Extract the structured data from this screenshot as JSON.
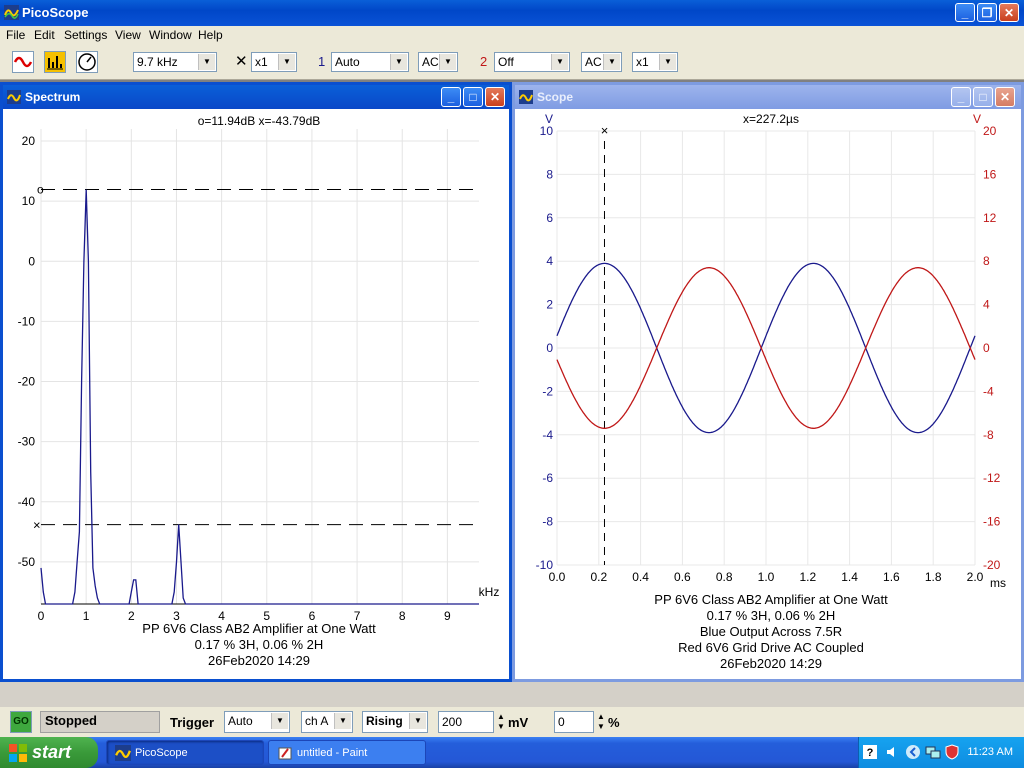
{
  "window": {
    "title": "PicoScope"
  },
  "menu": [
    "File",
    "Edit",
    "Settings",
    "View",
    "Window",
    "Help"
  ],
  "toolbar": {
    "timebase": "9.7 kHz",
    "multiplier_symbol": "✕",
    "multiplier": "x1",
    "ch1_label": "1",
    "ch1_range": "Auto",
    "ch1_coupling": "AC",
    "ch2_label": "2",
    "ch2_range": "Off",
    "ch2_coupling": "AC",
    "ch2_multiplier": "x1"
  },
  "spectrum": {
    "title": "Spectrum",
    "readout": "o=11.94dB  x=-43.79dB",
    "y_ticks": [
      "20",
      "10",
      "0",
      "-10",
      "-20",
      "-30",
      "-40",
      "-50"
    ],
    "x_ticks": [
      "0",
      "1",
      "2",
      "3",
      "4",
      "5",
      "6",
      "7",
      "8",
      "9"
    ],
    "x_unit": "kHz",
    "marker_o": "o",
    "marker_x": "×",
    "caption": [
      "PP 6V6 Class AB2 Amplifier at One Watt",
      "0.17 % 3H, 0.06 % 2H",
      "26Feb2020  14:29"
    ]
  },
  "scope": {
    "title": "Scope",
    "readout": "x=227.2µs",
    "left_unit": "V",
    "right_unit": "V",
    "marker_x": "×",
    "left_ticks": [
      "10",
      "8",
      "6",
      "4",
      "2",
      "0",
      "-2",
      "-4",
      "-6",
      "-8",
      "-10"
    ],
    "right_ticks": [
      "20",
      "16",
      "12",
      "8",
      "4",
      "0",
      "-4",
      "-8",
      "-12",
      "-16",
      "-20"
    ],
    "x_ticks": [
      "0.0",
      "0.2",
      "0.4",
      "0.6",
      "0.8",
      "1.0",
      "1.2",
      "1.4",
      "1.6",
      "1.8",
      "2.0"
    ],
    "x_unit": "ms",
    "caption": [
      "PP 6V6 Class AB2 Amplifier at One Watt",
      "0.17 % 3H, 0.06 % 2H",
      "Blue Output Across 7.5R",
      "Red 6V6 Grid Drive AC Coupled",
      "26Feb2020  14:29"
    ]
  },
  "statusbar": {
    "go_label": "GO",
    "status": "Stopped",
    "trigger_label": "Trigger",
    "trigger_mode": "Auto",
    "trigger_channel": "ch A",
    "trigger_edge": "Rising",
    "threshold": "200",
    "threshold_unit": "mV",
    "delay": "0",
    "delay_unit": "%"
  },
  "taskbar": {
    "start": "start",
    "tasks": [
      "PicoScope",
      "untitled - Paint"
    ],
    "clock": "11:23 AM"
  },
  "colors": {
    "ch_a": "#1a1a8c",
    "ch_b": "#c01818",
    "title_blue": "#0a4fcf"
  },
  "chart_data": [
    {
      "type": "line",
      "title": "Spectrum",
      "xlabel": "kHz",
      "ylabel": "dB",
      "xlim": [
        0,
        9.7
      ],
      "ylim": [
        -57,
        22
      ],
      "grid": true,
      "series": [
        {
          "values_x": [
            0,
            0.05,
            0.1,
            0.7,
            0.75,
            0.8,
            0.85,
            0.9,
            0.95,
            1.0,
            1.05,
            1.1,
            1.15,
            1.2,
            1.25,
            1.3,
            1.95,
            2.0,
            2.05,
            2.1,
            2.15,
            2.9,
            2.95,
            3.0,
            3.05,
            3.1,
            3.15,
            3.2,
            9.7
          ],
          "values_y": [
            -51,
            -55,
            -57,
            -57,
            -55,
            -50,
            -45,
            -20,
            0,
            11.9,
            0,
            -35,
            -51,
            -54,
            -56,
            -57,
            -57,
            -55,
            -53,
            -53,
            -57,
            -57,
            -55,
            -50,
            -43.8,
            -50,
            -56,
            -57,
            -57
          ]
        }
      ],
      "cursors": {
        "o_level": 11.94,
        "x_level": -43.79
      }
    },
    {
      "type": "line",
      "title": "Scope",
      "xlabel": "ms",
      "ylabel_left": "V",
      "ylabel_right": "V",
      "xlim": [
        0,
        2.0
      ],
      "ylim_left": [
        -10,
        10
      ],
      "ylim_right": [
        -20,
        20
      ],
      "grid": true,
      "series": [
        {
          "name": "Blue Output Across 7.5R",
          "axis": "left",
          "amplitude": 3.9,
          "period_ms": 1.0,
          "peak_at_ms": 0.227
        },
        {
          "name": "Red 6V6 Grid Drive AC Coupled",
          "axis": "right",
          "amplitude": 7.4,
          "period_ms": 1.0,
          "peak_at_ms": 0.727
        }
      ],
      "cursor_x_ms": 0.2272
    }
  ]
}
